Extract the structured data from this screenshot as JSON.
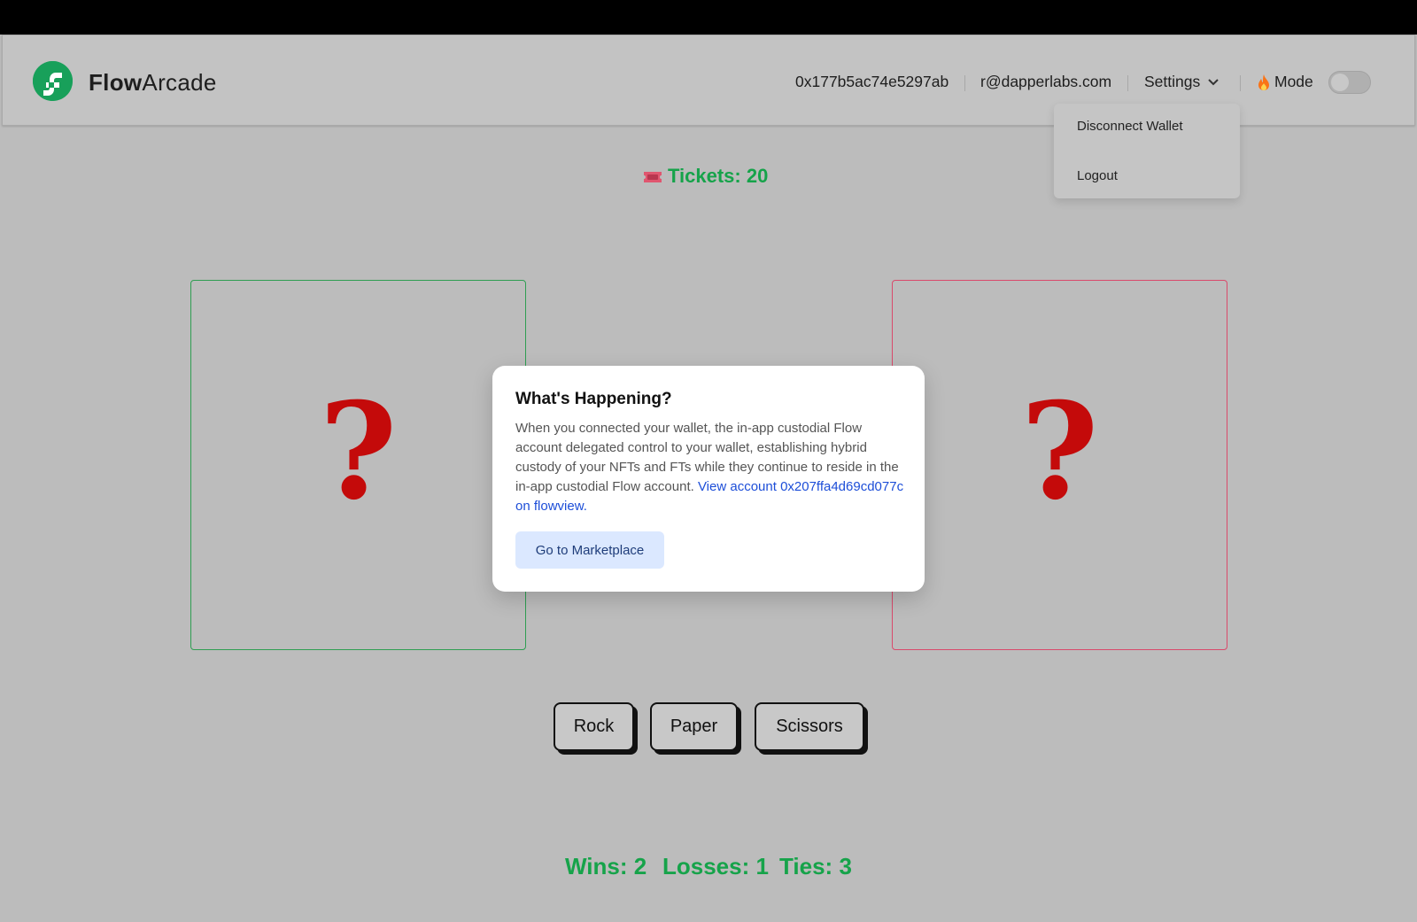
{
  "brand": {
    "bold": "Flow",
    "light": "Arcade"
  },
  "header": {
    "address": "0x177b5ac74e5297ab",
    "email": "r@dapperlabs.com",
    "settings_label": "Settings",
    "mode_label": "Mode"
  },
  "settings_menu": {
    "items": [
      {
        "label": "Disconnect Wallet"
      },
      {
        "label": "Logout"
      }
    ]
  },
  "tickets": {
    "label": "Tickets: 20"
  },
  "cards": {
    "left_symbol": "?",
    "right_symbol": "?"
  },
  "modal": {
    "title": "What's Happening?",
    "body": "When you connected your wallet, the in-app custodial Flow account delegated control to your wallet, establishing hybrid custody of your NFTs and FTs while they continue to reside in the in-app custodial Flow account. ",
    "link": "View account 0x207ffa4d69cd077c on flowview.",
    "button_label": "Go to Marketplace"
  },
  "choices": [
    {
      "label": "Rock"
    },
    {
      "label": "Paper"
    },
    {
      "label": "Scissors"
    }
  ],
  "score": {
    "wins": "Wins: 2",
    "losses": "Losses: 1",
    "ties": "Ties: 3"
  },
  "colors": {
    "accent_green": "#16a34a",
    "brand_green": "#18a05a",
    "opponent_red": "#d94a6b",
    "link_blue": "#1d4ed8"
  }
}
